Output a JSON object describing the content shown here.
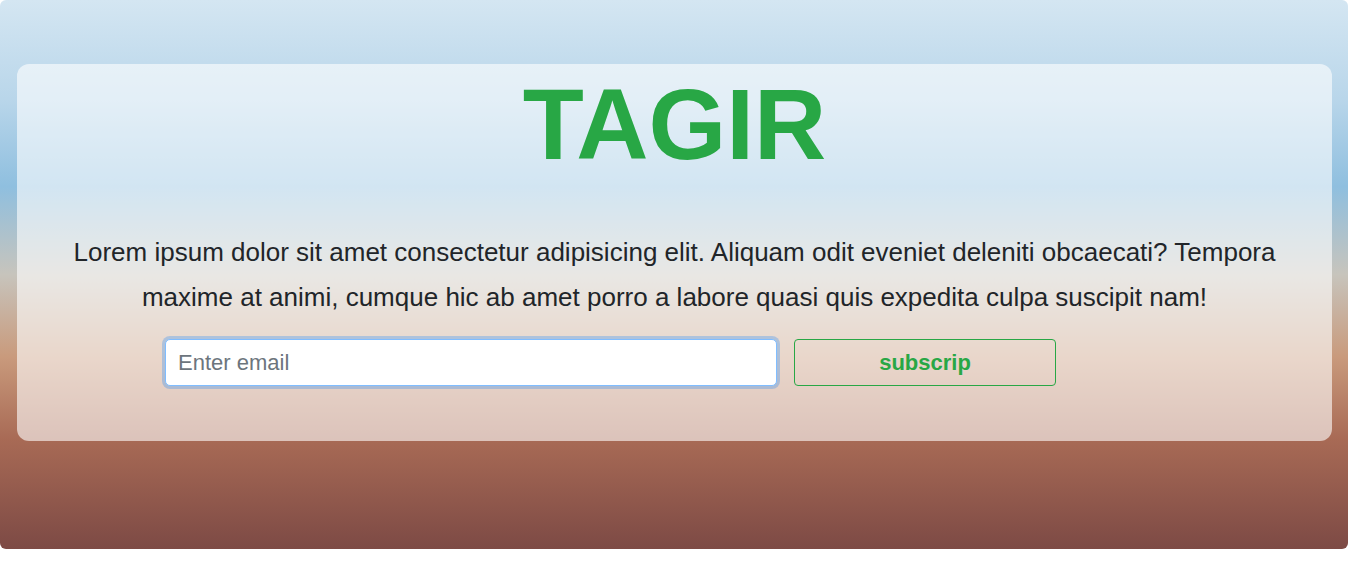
{
  "hero": {
    "title": "TAGIR",
    "text": "Lorem ipsum dolor sit amet consectetur adipisicing elit. Aliquam odit eveniet deleniti obcaecati? Tempora maxime at animi, cumque hic ab amet porro a labore quasi quis expedita culpa suscipit nam!"
  },
  "form": {
    "email_placeholder": "Enter email",
    "button": "subscrip"
  }
}
